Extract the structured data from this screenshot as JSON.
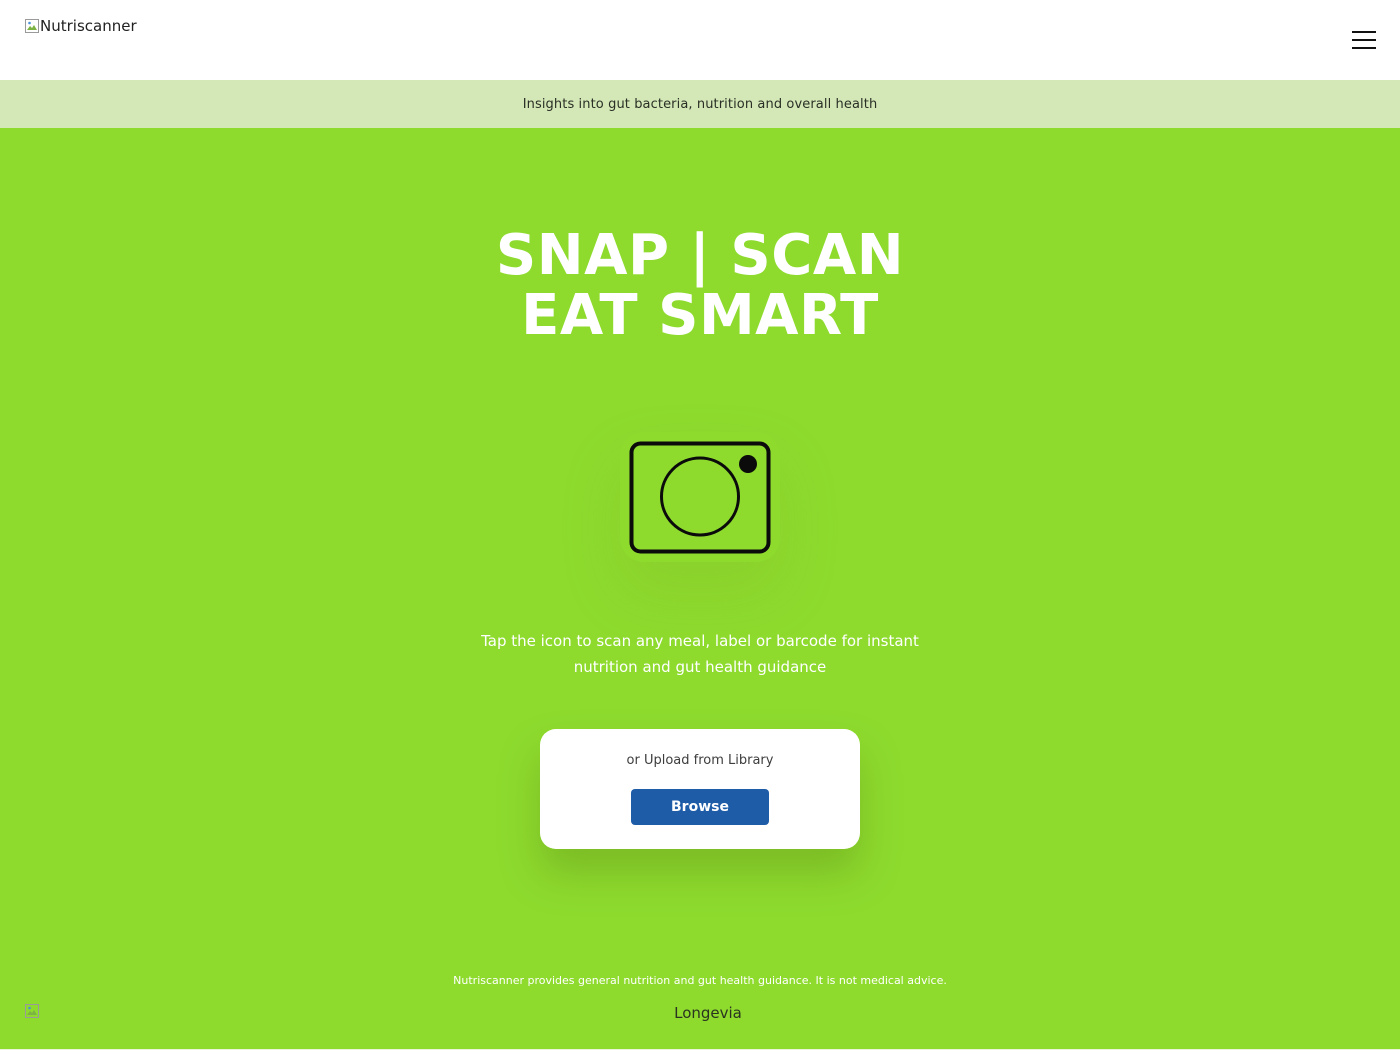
{
  "header": {
    "logo_alt": "Nutriscanner",
    "menu_icon": "hamburger-menu-icon"
  },
  "banner": {
    "text": "Insights into gut bacteria, nutrition and overall health"
  },
  "hero": {
    "title_line1": "SNAP | SCAN",
    "title_line2": "EAT SMART",
    "camera_icon": "camera-icon",
    "instruction": "Tap the icon to scan any meal, label or barcode for instant nutrition and gut health guidance"
  },
  "upload": {
    "label": "or Upload from Library",
    "button_label": "Browse"
  },
  "footer": {
    "disclaimer": "Nutriscanner provides general nutrition and gut health guidance. It is not medical advice.",
    "partner_name": "Longevia"
  },
  "colors": {
    "background": "#8edb2e",
    "banner": "#d3e8b6",
    "button": "#1e5ca8",
    "header": "#ffffff"
  }
}
